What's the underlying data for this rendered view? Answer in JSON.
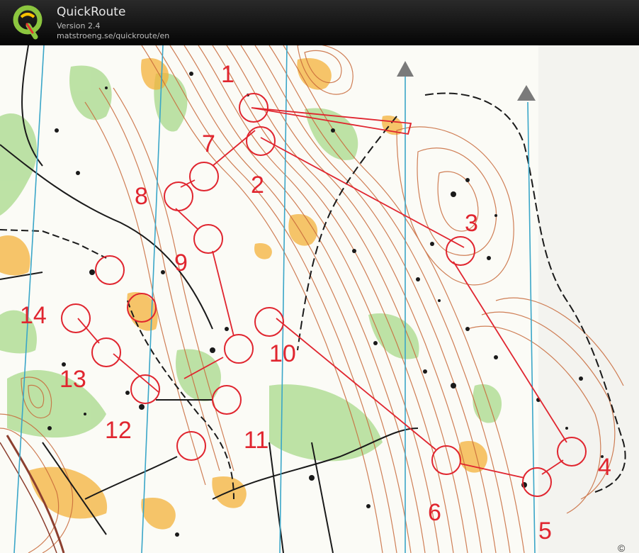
{
  "app": {
    "title": "QuickRoute",
    "version": "Version 2.4",
    "url": "matstroeng.se/quickroute/en"
  },
  "map": {
    "controls": [
      {
        "label": "1"
      },
      {
        "label": "2"
      },
      {
        "label": "3"
      },
      {
        "label": "4"
      },
      {
        "label": "5"
      },
      {
        "label": "6"
      },
      {
        "label": "7"
      },
      {
        "label": "8"
      },
      {
        "label": "9"
      },
      {
        "label": "10"
      },
      {
        "label": "11"
      },
      {
        "label": "12"
      },
      {
        "label": "13"
      },
      {
        "label": "14"
      }
    ],
    "colors": {
      "course": "#e0252f",
      "contour": "#c8693a",
      "water": "#3aa6c8",
      "vegetation": "#a8d98a",
      "open_land": "#f4b23a"
    },
    "copyright_symbol": "©"
  }
}
